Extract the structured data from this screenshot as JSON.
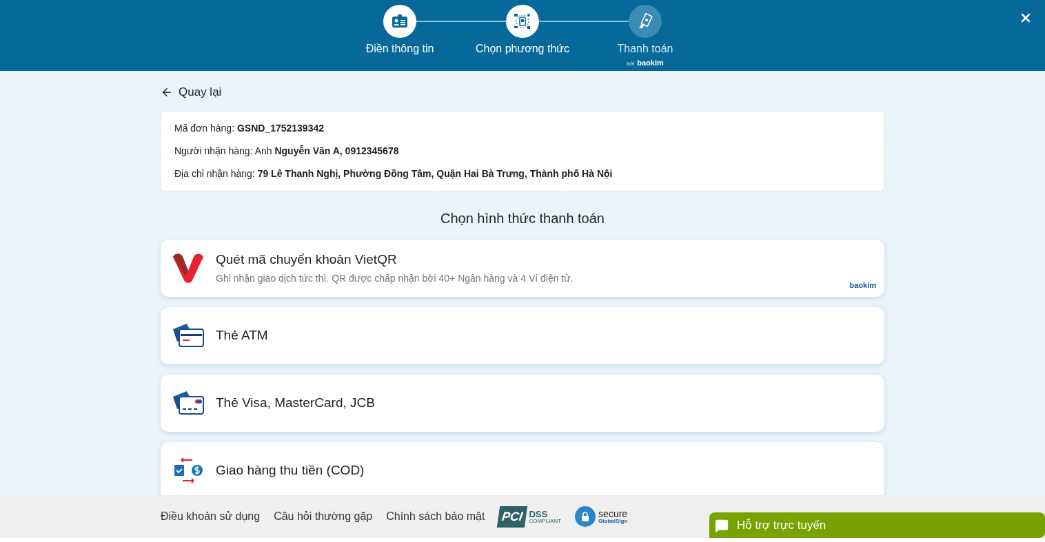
{
  "steps": [
    {
      "label": "Điền thông tin",
      "active": true,
      "kind": "id"
    },
    {
      "label": "Chọn phương thức",
      "active": true,
      "kind": "network"
    },
    {
      "label": "Thanh toán",
      "active": false,
      "kind": "cash",
      "by": "bởi",
      "brand": "baokim"
    }
  ],
  "back_link": "Quay lại",
  "order_info": [
    "Mã đơn hàng: **GSND_1752139342**",
    "Người nhận hàng: Anh **Nguyễn Văn A, 0912345678**",
    "Địa chỉ nhận hàng: **79 Lê Thanh Nghị, Phường Đồng Tâm, Quận Hai Bà Trưng, Thành phố Hà Nội**"
  ],
  "section_title": "Chọn hình thức thanh toán",
  "methods": [
    {
      "kind": "vietqr",
      "title": "Quét mã chuyển khoản VietQR",
      "description": "Ghi nhận giao dịch tức thì. QR được chấp nhận bởi 40+ Ngân hàng và 4 Ví điện tử.",
      "provider": "baokim"
    },
    {
      "kind": "atm",
      "title": "Thẻ ATM"
    },
    {
      "kind": "visa",
      "title": "Thẻ Visa, MasterCard, JCB"
    },
    {
      "kind": "cod",
      "title": "Giao hàng thu tiền (COD)"
    }
  ],
  "footer_links": [
    "Điều khoản sử dụng",
    "Câu hỏi thường gặp",
    "Chính sách bảo mật"
  ],
  "badges": {
    "pci": [
      "PCI",
      "DSS",
      "COMPLIANT"
    ],
    "secure": [
      "secure",
      "GlobalSign"
    ]
  },
  "chat_button": "Hỗ trợ trực tuyến"
}
